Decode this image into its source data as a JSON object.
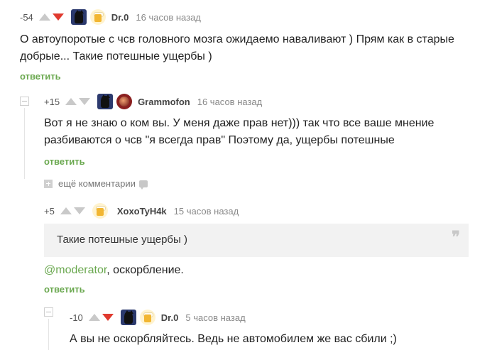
{
  "comments": [
    {
      "rating": "-54",
      "author": "Dr.0",
      "time": "16 часов назад",
      "text_line1": "О автоупоротые с чсв головного мозга ожидаемо наваливают ) Прям как в старые",
      "text_line2": "добрые... Такие потешные ущербы )",
      "reply": "ответить",
      "vote": "down"
    },
    {
      "rating": "+15",
      "author": "Grammofon",
      "time": "16 часов назад",
      "text_line1": "Вот я не знаю о ком вы. У меня даже прав нет))) так что все ваше мнение",
      "text_line2": "разбиваются о чсв \"я всегда прав\" Поэтому да, ущербы потешные",
      "reply": "ответить"
    },
    {
      "rating": "+5",
      "author": "XoxoTyH4k",
      "time": "15 часов назад",
      "quote": "Такие потешные ущербы )",
      "mention": "@moderator",
      "text_after_mention": ", оскорбление.",
      "reply": "ответить"
    },
    {
      "rating": "-10",
      "author": "Dr.0",
      "time": "5 часов назад",
      "text_line1": "А вы не оскорбляйтесь. Ведь не автомобилем же вас сбили ;)",
      "vote": "down"
    }
  ],
  "more_comments": "ещё комментарии",
  "colors": {
    "accent_green": "#6aa84f",
    "downvote_red": "#e03a2f"
  }
}
